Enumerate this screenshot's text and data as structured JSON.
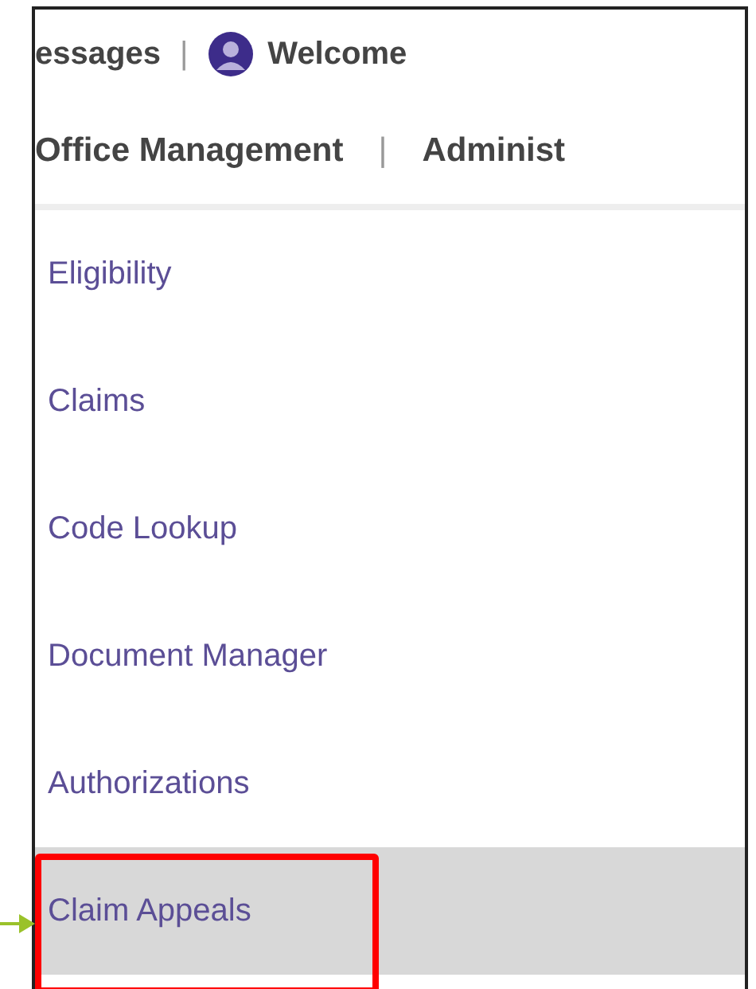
{
  "header": {
    "messages_link": "essages",
    "separator": "|",
    "welcome": "Welcome"
  },
  "nav": {
    "items": [
      {
        "label": "Office Management"
      },
      {
        "label": "Administ"
      }
    ],
    "separator": "|"
  },
  "menu": {
    "items": [
      {
        "label": "Eligibility",
        "selected": false,
        "highlighted": false
      },
      {
        "label": "Claims",
        "selected": false,
        "highlighted": false
      },
      {
        "label": "Code Lookup",
        "selected": false,
        "highlighted": false
      },
      {
        "label": "Document Manager",
        "selected": false,
        "highlighted": false
      },
      {
        "label": "Authorizations",
        "selected": false,
        "highlighted": false
      },
      {
        "label": "Claim Appeals",
        "selected": true,
        "highlighted": true
      }
    ]
  }
}
